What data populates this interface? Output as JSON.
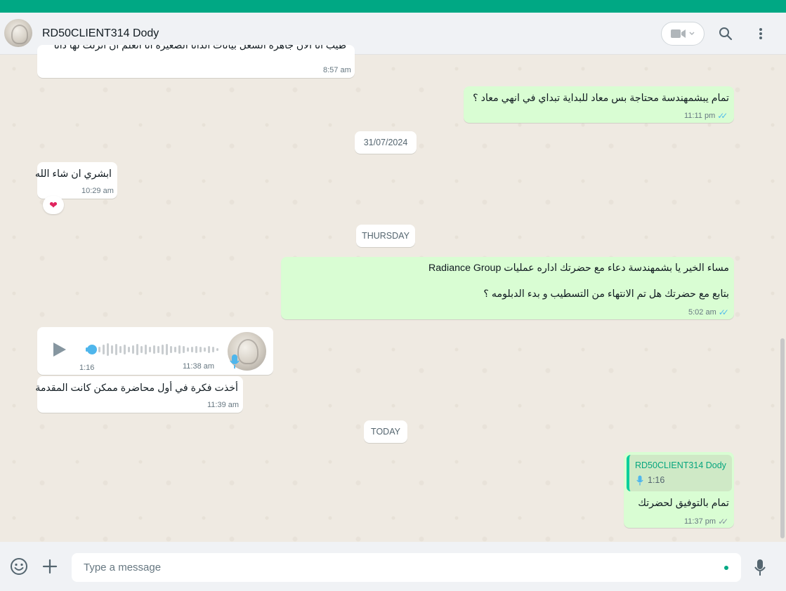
{
  "header": {
    "contact_name": "RD50CLIENT314 Dody"
  },
  "messages": {
    "m1": {
      "text": "طيب انا الان جاهزة الشغل بيانات الداتا الصغيرة انا اتعلم ان انزلت لها داتا",
      "time": "8:57 am"
    },
    "m2": {
      "text": "تمام يبشمهندسة محتاجة بس معاد للبداية تبداي في انهي معاد ؟",
      "time": "11:11 pm"
    },
    "date1": "31/07/2024",
    "m3": {
      "text": "ابشري ان شاء الله",
      "time": "10:29 am",
      "reaction": "❤"
    },
    "date2": "THURSDAY",
    "m4": {
      "line1": "مساء الخير يا بشمهندسة دعاء مع  حضرتك اداره عمليات Radiance Group",
      "line2": "بتابع مع حضرتك هل تم الانتهاء من التسطيب و بدء الدبلومه ؟",
      "time": "5:02 am"
    },
    "m5": {
      "duration": "1:16",
      "time": "11:38 am"
    },
    "m6": {
      "text": "أخذت فكرة في أول محاضرة ممكن كانت المقدمة",
      "time": "11:39 am"
    },
    "date3": "TODAY",
    "m7": {
      "quoted_name": "RD50CLIENT314 Dody",
      "quoted_duration": "1:16",
      "text": "تمام بالتوفيق لحضرتك",
      "time": "11:37 pm"
    }
  },
  "composer": {
    "placeholder": "Type a message"
  },
  "colors": {
    "accent": "#00a884",
    "outgoing_bubble": "#d9fdd3",
    "incoming_bubble": "#ffffff",
    "read_ticks": "#53bdeb"
  },
  "icons": {
    "header": [
      "video-call-icon",
      "search-icon",
      "menu-dots-icon"
    ],
    "composer": [
      "emoji-icon",
      "attach-plus-icon",
      "mic-icon"
    ]
  }
}
